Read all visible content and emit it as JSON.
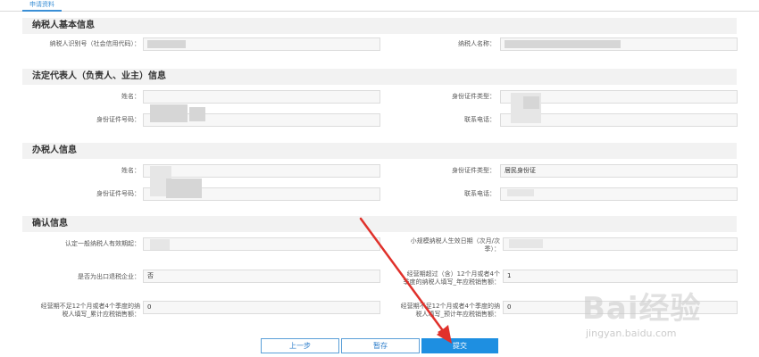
{
  "tabs": {
    "active_label": "申请资料"
  },
  "section_basic": {
    "title": "纳税人基本信息",
    "taxpayer_id_label": "纳税人识别号（社会信用代码）：",
    "taxpayer_id_value": "",
    "taxpayer_name_label": "纳税人名称：",
    "taxpayer_name_value": ""
  },
  "section_legal": {
    "title": "法定代表人（负责人、业主）信息",
    "name_label": "姓名：",
    "id_type_label": "身份证件类型：",
    "id_number_label": "身份证件号码：",
    "phone_label": "联系电话："
  },
  "section_agent": {
    "title": "办税人信息",
    "name_label": "姓名：",
    "id_type_label": "身份证件类型：",
    "id_type_value": "居民身份证",
    "id_number_label": "身份证件号码：",
    "phone_label": "联系电话："
  },
  "section_confirm": {
    "title": "确认信息",
    "effective_period_label": "认定一般纳税人有效期起：",
    "small_scale_effective_label_1": "小规模纳税人生效日期（次月/次",
    "small_scale_effective_label_2": "季）：",
    "export_label": "是否为出口退税企业：",
    "export_value": "否",
    "over12_label_1": "经营期超过（含）12个月或者4个",
    "over12_label_2": "季度的纳税人填写_年应税销售额：",
    "over12_value": "1",
    "under12_cum_label_1": "经营期不足12个月或者4个季度的纳",
    "under12_cum_label_2": "税人填写_累计应税销售额：",
    "under12_cum_value": "0",
    "under12_pred_label_1": "经营期不足12个月或者4个季度的纳",
    "under12_pred_label_2": "税人填写_预计年应税销售额：",
    "under12_pred_value": "0"
  },
  "buttons": {
    "prev": "上一步",
    "save": "暂存",
    "submit": "提交"
  },
  "watermark": {
    "main": "Bai经验",
    "sub": "jingyan.baidu.com"
  },
  "colors": {
    "accent": "#1e8fe1",
    "arrow": "#e0312b"
  }
}
